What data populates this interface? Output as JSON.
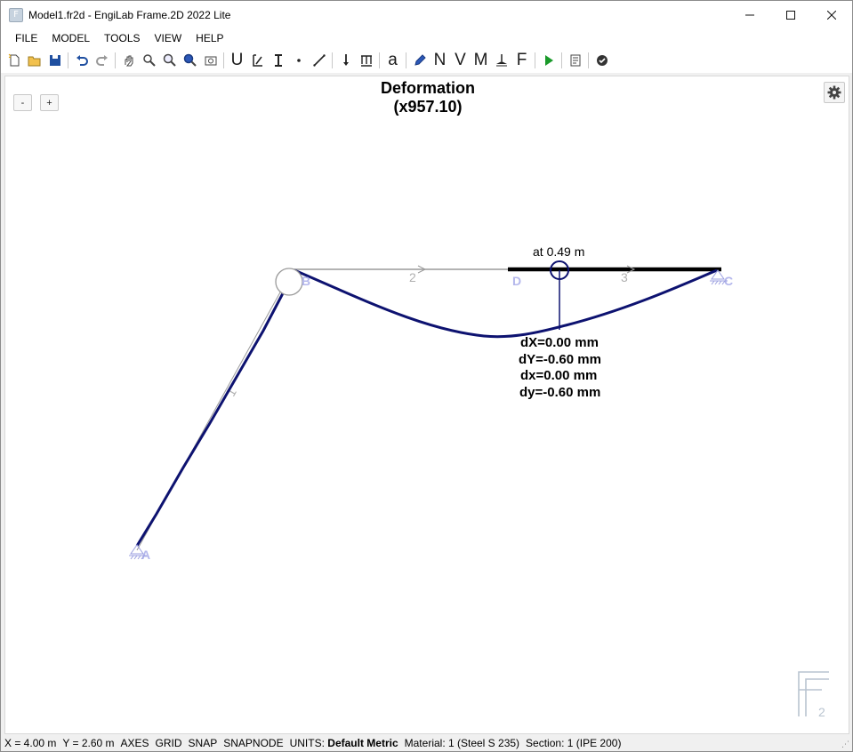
{
  "window": {
    "title": "Model1.fr2d - EngiLab Frame.2D 2022 Lite",
    "app_icon": "frame2d-app-icon",
    "controls": [
      "minimize-icon",
      "maximize-icon",
      "close-icon"
    ]
  },
  "menu": [
    "FILE",
    "MODEL",
    "TOOLS",
    "VIEW",
    "HELP"
  ],
  "toolbar": {
    "letters": {
      "u": "U",
      "n": "N",
      "v": "V",
      "m": "M",
      "f": "F",
      "a": "a"
    }
  },
  "canvas": {
    "title_line1": "Deformation",
    "title_line2": "(x957.10)",
    "zoom_out": "-",
    "zoom_in": "+",
    "settings_icon": "gear-icon",
    "probe_label": "at 0.49 m",
    "readout": [
      "dX=0.00 mm",
      "dY=-0.60 mm",
      "dx=0.00 mm",
      "dy=-0.60 mm"
    ],
    "nodes": {
      "a": "A",
      "b": "B",
      "c": "C",
      "d": "D"
    },
    "members": {
      "m1": "1",
      "m2": "2",
      "m3": "3"
    },
    "colors": {
      "deformed": "#0d1270",
      "undeformed": "#9a9a9a",
      "support": "#9b9fe0",
      "selected": "#000000"
    }
  },
  "statusbar": {
    "x": "X = 4.00 m",
    "y": "Y = 2.60 m",
    "axes": "AXES",
    "grid": "GRID",
    "snap": "SNAP",
    "snapnode": "SNAPNODE",
    "units_label": "UNITS:",
    "units_value": "Default Metric",
    "material": "Material: 1 (Steel S 235)",
    "section": "Section: 1 (IPE 200)"
  }
}
